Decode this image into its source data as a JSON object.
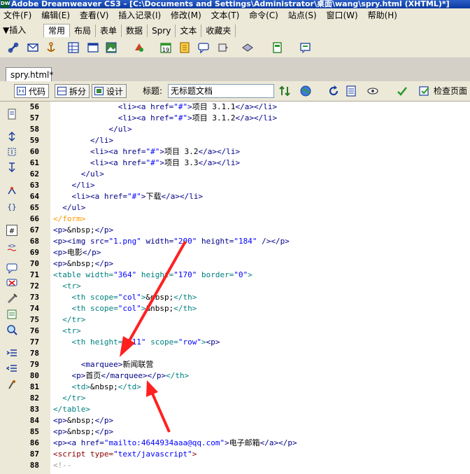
{
  "window": {
    "app_icon": "DW",
    "title": "Adobe Dreamweaver CS3 - [C:\\Documents and Settings\\Administrator\\桌面\\wang\\spry.html (XHTML)*]"
  },
  "menu": [
    "文件(F)",
    "编辑(E)",
    "查看(V)",
    "插入记录(I)",
    "修改(M)",
    "文本(T)",
    "命令(C)",
    "站点(S)",
    "窗口(W)",
    "帮助(H)"
  ],
  "insert_bar": {
    "label": "▼插入",
    "tabs": [
      "常用",
      "布局",
      "表单",
      "数据",
      "Spry",
      "文本",
      "收藏夹"
    ],
    "active_tab": 0
  },
  "document": {
    "tab": "spry.html*",
    "views": [
      "代码",
      "拆分",
      "设计"
    ],
    "title_label": "标题:",
    "title_value": "无标题文档",
    "check_page": "检查页面"
  },
  "code_lines": [
    {
      "n": "56",
      "indent": "              ",
      "parts": [
        [
          "tg",
          "<li>"
        ],
        [
          "tg",
          "<a "
        ],
        [
          "at",
          "href="
        ],
        [
          "vl",
          "\"#\""
        ],
        [
          "tg",
          ">"
        ],
        [
          "bl",
          "项目 3.1.1"
        ],
        [
          "tg",
          "</a></li>"
        ]
      ]
    },
    {
      "n": "57",
      "indent": "              ",
      "parts": [
        [
          "tg",
          "<li>"
        ],
        [
          "tg",
          "<a "
        ],
        [
          "at",
          "href="
        ],
        [
          "vl",
          "\"#\""
        ],
        [
          "tg",
          ">"
        ],
        [
          "bl",
          "项目 3.1.2"
        ],
        [
          "tg",
          "</a></li>"
        ]
      ]
    },
    {
      "n": "58",
      "indent": "            ",
      "parts": [
        [
          "tg",
          "</ul>"
        ]
      ]
    },
    {
      "n": "59",
      "indent": "        ",
      "parts": [
        [
          "tg",
          "</li>"
        ]
      ]
    },
    {
      "n": "60",
      "indent": "        ",
      "parts": [
        [
          "tg",
          "<li>"
        ],
        [
          "tg",
          "<a "
        ],
        [
          "at",
          "href="
        ],
        [
          "vl",
          "\"#\""
        ],
        [
          "tg",
          ">"
        ],
        [
          "bl",
          "项目 3.2"
        ],
        [
          "tg",
          "</a></li>"
        ]
      ]
    },
    {
      "n": "61",
      "indent": "        ",
      "parts": [
        [
          "tg",
          "<li>"
        ],
        [
          "tg",
          "<a "
        ],
        [
          "at",
          "href="
        ],
        [
          "vl",
          "\"#\""
        ],
        [
          "tg",
          ">"
        ],
        [
          "bl",
          "项目 3.3"
        ],
        [
          "tg",
          "</a></li>"
        ]
      ]
    },
    {
      "n": "62",
      "indent": "      ",
      "parts": [
        [
          "tg",
          "</ul>"
        ]
      ]
    },
    {
      "n": "63",
      "indent": "    ",
      "parts": [
        [
          "tg",
          "</li>"
        ]
      ]
    },
    {
      "n": "64",
      "indent": "    ",
      "parts": [
        [
          "tg",
          "<li>"
        ],
        [
          "tg",
          "<a "
        ],
        [
          "at",
          "href="
        ],
        [
          "vl",
          "\"#\""
        ],
        [
          "tg",
          ">"
        ],
        [
          "bl",
          "下载"
        ],
        [
          "tg",
          "</a></li>"
        ]
      ]
    },
    {
      "n": "65",
      "indent": "  ",
      "parts": [
        [
          "tg",
          "</ul>"
        ]
      ]
    },
    {
      "n": "66",
      "indent": "",
      "parts": [
        [
          "fm",
          "</form>"
        ]
      ]
    },
    {
      "n": "67",
      "indent": "",
      "parts": [
        [
          "tg",
          "<p>"
        ],
        [
          "bl",
          "&nbsp;"
        ],
        [
          "tg",
          "</p>"
        ]
      ]
    },
    {
      "n": "68",
      "indent": "",
      "parts": [
        [
          "tg",
          "<p>"
        ],
        [
          "tg",
          "<img "
        ],
        [
          "at",
          "src="
        ],
        [
          "vl",
          "\"1.png\""
        ],
        [
          "at",
          " width="
        ],
        [
          "vl",
          "\"200\""
        ],
        [
          "at",
          " height="
        ],
        [
          "vl",
          "\"184\""
        ],
        [
          "tg",
          " /></p>"
        ]
      ]
    },
    {
      "n": "69",
      "indent": "",
      "parts": [
        [
          "tg",
          "<p>"
        ],
        [
          "bl",
          "电影"
        ],
        [
          "tg",
          "</p>"
        ]
      ]
    },
    {
      "n": "70",
      "indent": "",
      "parts": [
        [
          "tg",
          "<p>"
        ],
        [
          "bl",
          "&nbsp;"
        ],
        [
          "tg",
          "</p>"
        ]
      ]
    },
    {
      "n": "71",
      "indent": "",
      "parts": [
        [
          "tb",
          "<table "
        ],
        [
          "tb",
          "width="
        ],
        [
          "vl",
          "\"364\""
        ],
        [
          "tb",
          " height="
        ],
        [
          "vl",
          "\"170\""
        ],
        [
          "tb",
          " border="
        ],
        [
          "vl",
          "\"0\""
        ],
        [
          "tb",
          ">"
        ]
      ]
    },
    {
      "n": "72",
      "indent": "  ",
      "parts": [
        [
          "tb",
          "<tr>"
        ]
      ]
    },
    {
      "n": "73",
      "indent": "    ",
      "parts": [
        [
          "tb",
          "<th "
        ],
        [
          "tb",
          "scope="
        ],
        [
          "vl",
          "\"col\""
        ],
        [
          "tb",
          ">"
        ],
        [
          "bl",
          "&nbsp;"
        ],
        [
          "tb",
          "</th>"
        ]
      ]
    },
    {
      "n": "74",
      "indent": "    ",
      "parts": [
        [
          "tb",
          "<th "
        ],
        [
          "tb",
          "scope="
        ],
        [
          "vl",
          "\"col\""
        ],
        [
          "tb",
          ">"
        ],
        [
          "bl",
          "&nbsp;"
        ],
        [
          "tb",
          "</th>"
        ]
      ]
    },
    {
      "n": "75",
      "indent": "  ",
      "parts": [
        [
          "tb",
          "</tr>"
        ]
      ]
    },
    {
      "n": "76",
      "indent": "  ",
      "parts": [
        [
          "tb",
          "<tr>"
        ]
      ]
    },
    {
      "n": "77",
      "indent": "    ",
      "parts": [
        [
          "tb",
          "<th "
        ],
        [
          "tb",
          "height="
        ],
        [
          "vl",
          "\"111\""
        ],
        [
          "tb",
          " scope="
        ],
        [
          "vl",
          "\"row\""
        ],
        [
          "tb",
          ">"
        ],
        [
          "tg",
          "<p>"
        ]
      ]
    },
    {
      "n": "78",
      "indent": "",
      "parts": []
    },
    {
      "n": "79",
      "indent": "      ",
      "parts": [
        [
          "tg",
          "<marquee>"
        ],
        [
          "bl",
          "新闻联营"
        ]
      ]
    },
    {
      "n": "80",
      "indent": "    ",
      "parts": [
        [
          "tg",
          "<p>"
        ],
        [
          "bl",
          "首页"
        ],
        [
          "tg",
          "</marquee></p>"
        ],
        [
          "tb",
          "</th>"
        ]
      ]
    },
    {
      "n": "81",
      "indent": "    ",
      "parts": [
        [
          "tb",
          "<td>"
        ],
        [
          "bl",
          "&nbsp;"
        ],
        [
          "tb",
          "</td>"
        ]
      ]
    },
    {
      "n": "82",
      "indent": "  ",
      "parts": [
        [
          "tb",
          "</tr>"
        ]
      ]
    },
    {
      "n": "83",
      "indent": "",
      "parts": [
        [
          "tb",
          "</table>"
        ]
      ]
    },
    {
      "n": "84",
      "indent": "",
      "parts": [
        [
          "tg",
          "<p>"
        ],
        [
          "bl",
          "&nbsp;"
        ],
        [
          "tg",
          "</p>"
        ]
      ]
    },
    {
      "n": "85",
      "indent": "",
      "parts": [
        [
          "tg",
          "<p>"
        ],
        [
          "bl",
          "&nbsp;"
        ],
        [
          "tg",
          "</p>"
        ]
      ]
    },
    {
      "n": "86",
      "indent": "",
      "parts": [
        [
          "tg",
          "<p>"
        ],
        [
          "tg",
          "<a "
        ],
        [
          "at",
          "href="
        ],
        [
          "vl",
          "\"mailto:4644934aaa@qq.com\""
        ],
        [
          "tg",
          ">"
        ],
        [
          "bl",
          "电子邮箱"
        ],
        [
          "tg",
          "</a></p>"
        ]
      ]
    },
    {
      "n": "87",
      "indent": "",
      "parts": [
        [
          "sc",
          "<script "
        ],
        [
          "sc",
          "type="
        ],
        [
          "vl",
          "\"text/javascript\""
        ],
        [
          "sc",
          ">"
        ]
      ]
    },
    {
      "n": "88",
      "indent": "",
      "parts": [
        [
          "cm",
          "<!--"
        ]
      ]
    }
  ]
}
